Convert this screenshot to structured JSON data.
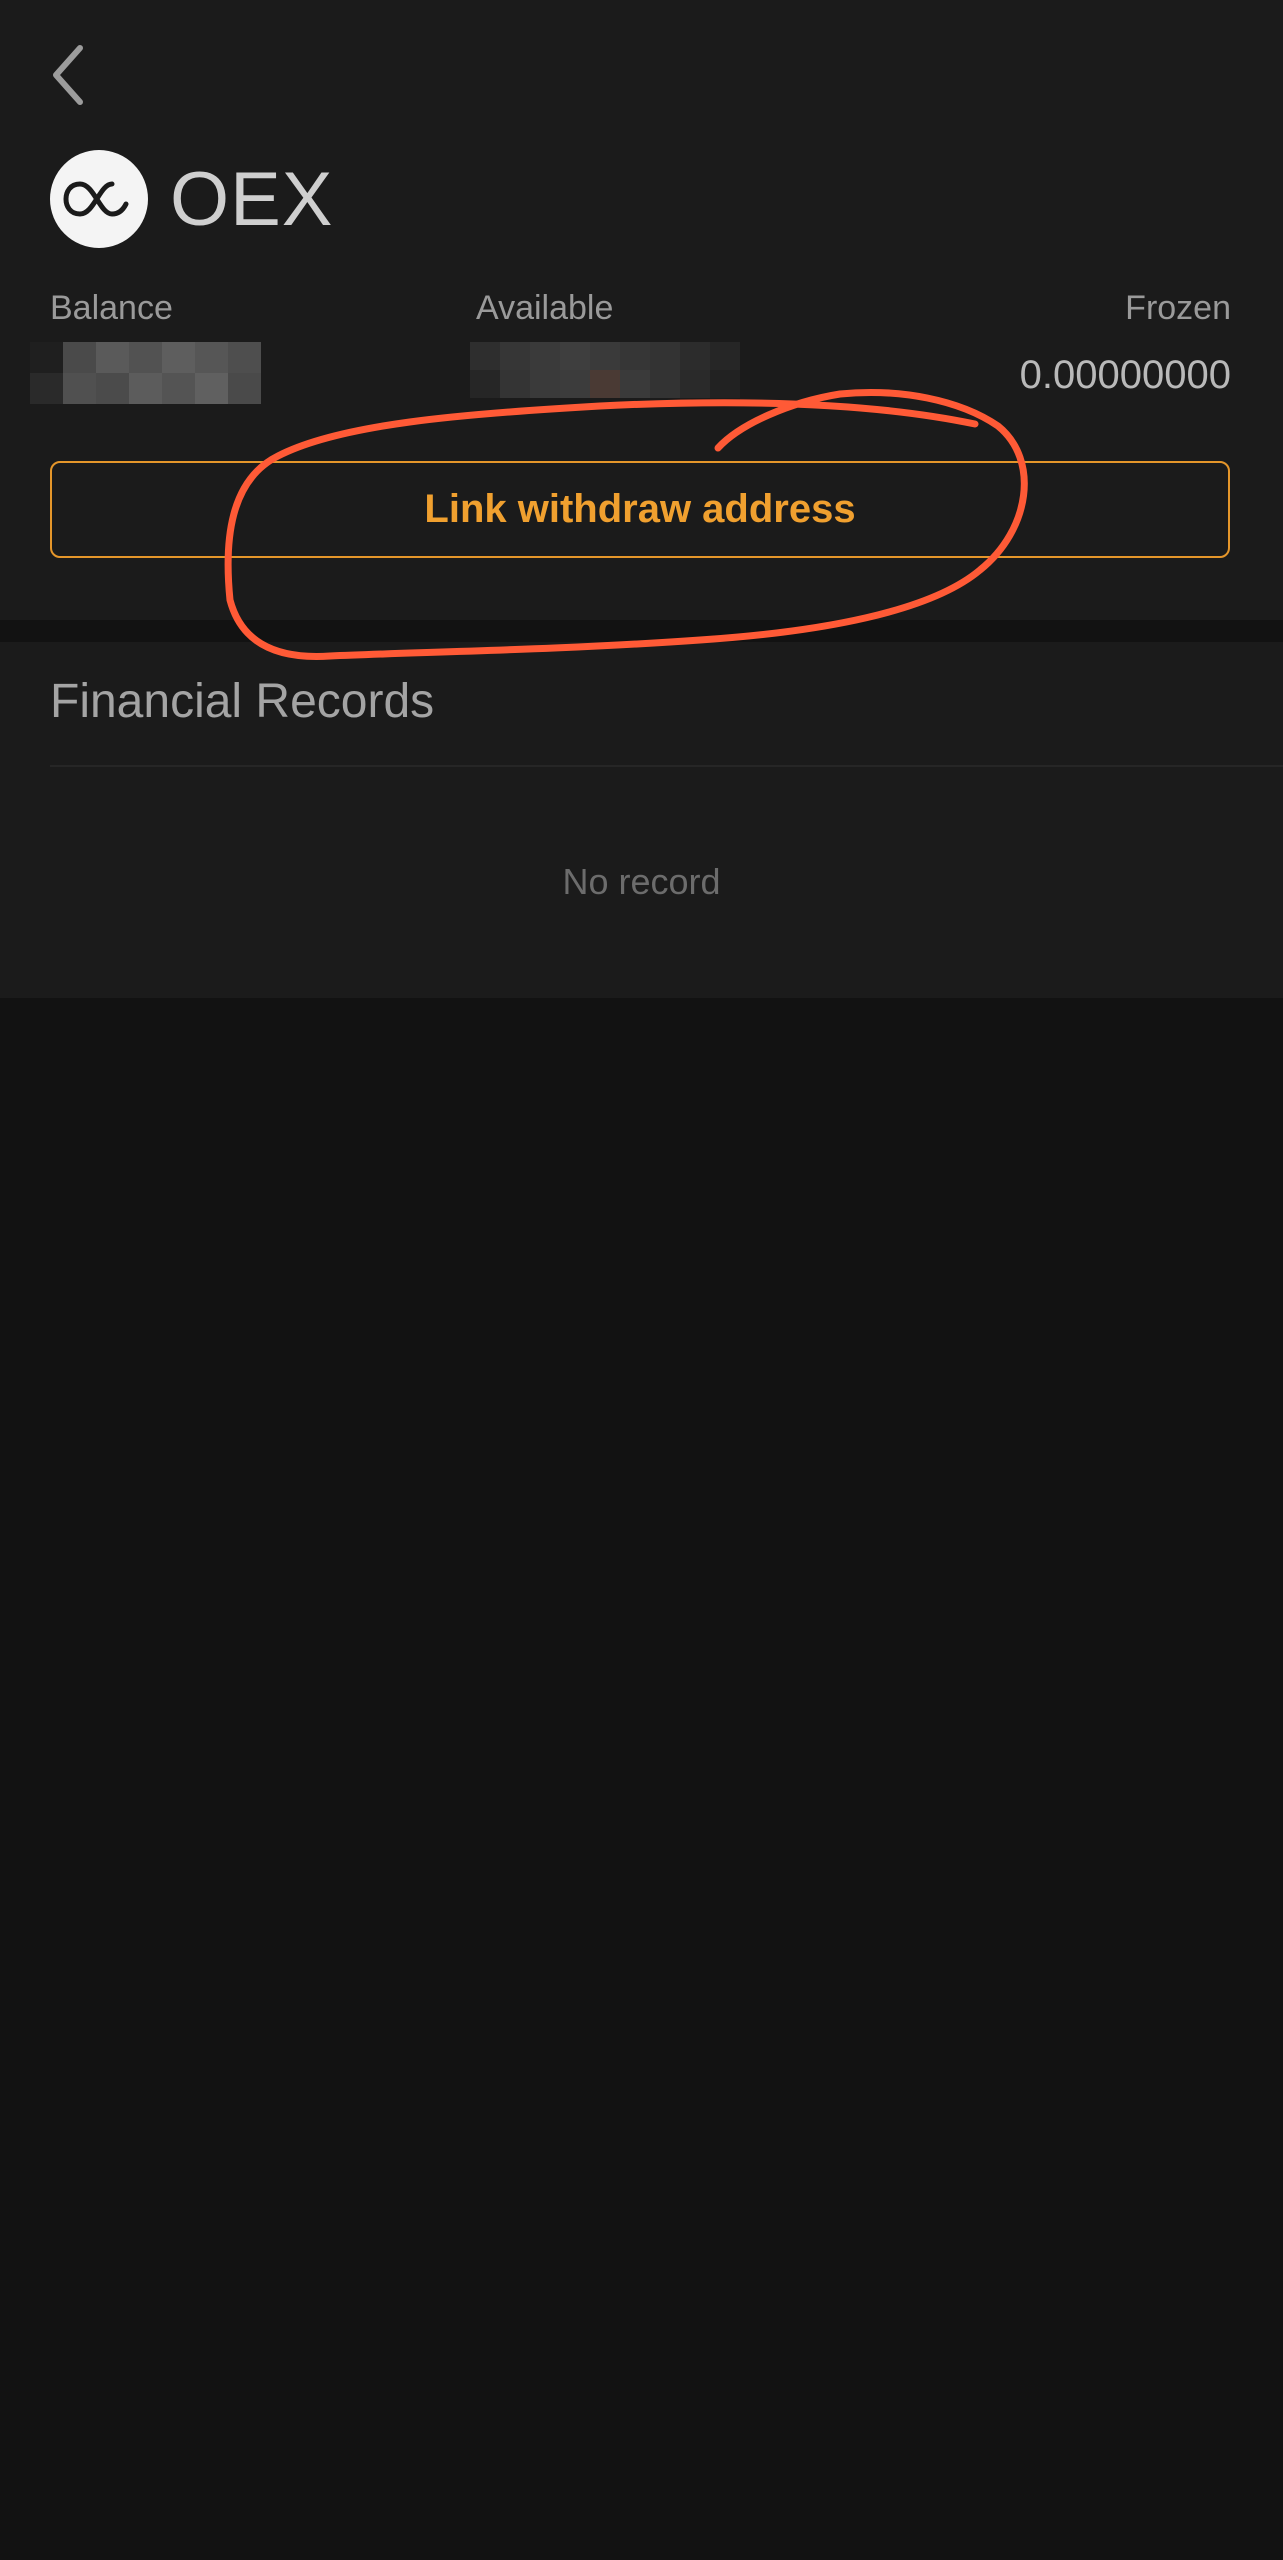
{
  "header": {
    "coin_name": "OEX",
    "back_icon": "chevron-left-icon",
    "logo_icon": "oex-logo-icon"
  },
  "stats": {
    "balance_label": "Balance",
    "available_label": "Available",
    "frozen_label": "Frozen",
    "balance_value_visible": "12",
    "available_value_visible": "",
    "frozen_value": "0.00000000"
  },
  "actions": {
    "link_withdraw_label": "Link withdraw address"
  },
  "records": {
    "title": "Financial Records",
    "empty_text": "No record"
  },
  "colors": {
    "background": "#121212",
    "panel": "#1b1b1b",
    "accent": "#f0a02f",
    "annotation": "#ff5a36"
  }
}
